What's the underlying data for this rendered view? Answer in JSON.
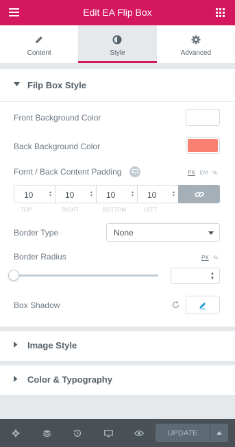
{
  "header": {
    "title": "Edit EA Flip Box",
    "menu_icon": "hamburger-icon",
    "apps_icon": "grid-icon"
  },
  "tabs": [
    {
      "label": "Content",
      "icon": "pencil-icon",
      "active": false
    },
    {
      "label": "Style",
      "icon": "half-circle-icon",
      "active": true
    },
    {
      "label": "Advanced",
      "icon": "gear-icon",
      "active": false
    }
  ],
  "flipbox_section": {
    "title": "Filp Box Style",
    "front_bg_label": "Front Background Color",
    "front_bg_color": "#ffffff",
    "back_bg_label": "Back Background Color",
    "back_bg_color": "#fa8072",
    "padding_label": "Fornt / Back Content Padding",
    "padding_units": {
      "px": "PX",
      "em": "EM",
      "pct": "%"
    },
    "padding": {
      "top": "10",
      "right": "10",
      "bottom": "10",
      "left": "10",
      "top_label": "TOP",
      "right_label": "RIGHT",
      "bottom_label": "BOTTOM",
      "left_label": "LEFT"
    },
    "border_type_label": "Border Type",
    "border_type_value": "None",
    "border_radius_label": "Border Radius",
    "radius_units": {
      "px": "PX",
      "pct": "%"
    },
    "radius_value": "",
    "box_shadow_label": "Box Shadow"
  },
  "collapsed_sections": [
    {
      "title": "Image Style"
    },
    {
      "title": "Color & Typography"
    }
  ],
  "footer": {
    "update_label": "UPDATE"
  },
  "colors": {
    "accent": "#d5175f",
    "footer_bg": "#495157",
    "link_active": "#a4afb7"
  }
}
